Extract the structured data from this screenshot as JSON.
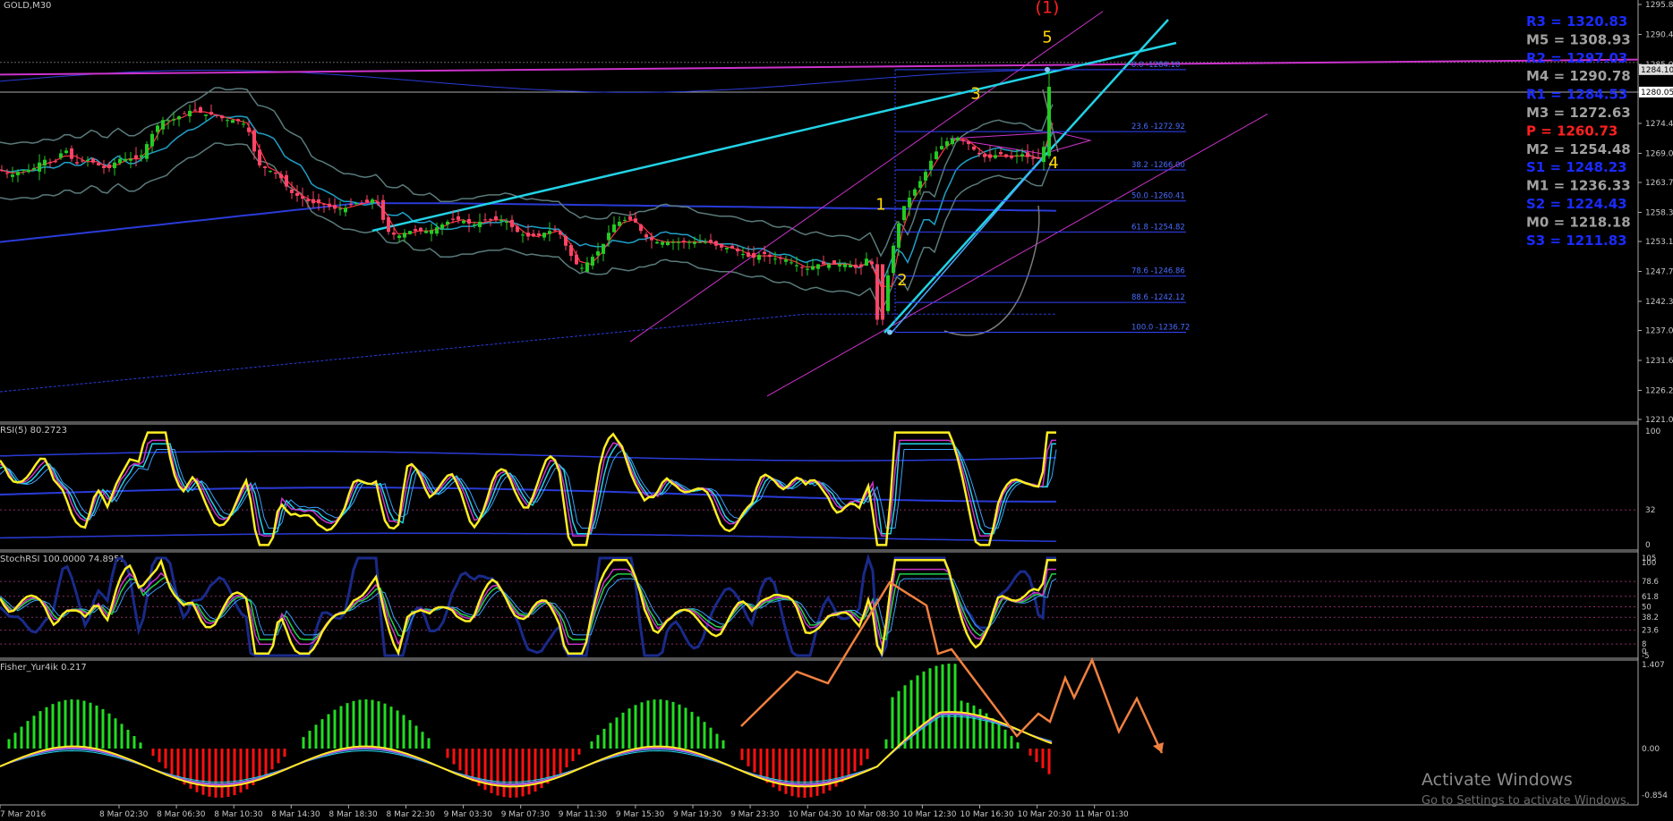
{
  "window": {
    "title": "GOLD,M30"
  },
  "colors": {
    "background": "#000000",
    "bull": "#22cc22",
    "bear": "#ff4466",
    "fib": "#3344ff",
    "channel": "#cc33cc",
    "trend": "#22d3e6",
    "wave": "#ffd700",
    "wave_major": "#ff2020",
    "forecast": "#f08040",
    "pivot_blue": "#1a2bff",
    "pivot_gray": "#a0a0a0",
    "pivot_red": "#ff2020"
  },
  "main_axis": {
    "price_labels": [
      "1295.85",
      "1290.45",
      "1285.05",
      "1280.05",
      "1274.40",
      "1269.00",
      "1263.75",
      "1258.35",
      "1253.10",
      "1247.70",
      "1242.30",
      "1237.05",
      "1231.65",
      "1226.25",
      "1221.00"
    ],
    "marker_top": "1284.10",
    "marker_current": "1280.05"
  },
  "pivots": [
    {
      "label": "R3",
      "value": "1320.83",
      "color": "blue"
    },
    {
      "label": "M5",
      "value": "1308.93",
      "color": "gray"
    },
    {
      "label": "R2",
      "value": "1297.03",
      "color": "blue"
    },
    {
      "label": "M4",
      "value": "1290.78",
      "color": "gray"
    },
    {
      "label": "R1",
      "value": "1284.53",
      "color": "blue"
    },
    {
      "label": "M3",
      "value": "1272.63",
      "color": "gray"
    },
    {
      "label": "P",
      "value": "1260.73",
      "color": "red"
    },
    {
      "label": "M2",
      "value": "1254.48",
      "color": "gray"
    },
    {
      "label": "S1",
      "value": "1248.23",
      "color": "blue"
    },
    {
      "label": "M1",
      "value": "1236.33",
      "color": "gray"
    },
    {
      "label": "S2",
      "value": "1224.43",
      "color": "blue"
    },
    {
      "label": "M0",
      "value": "1218.18",
      "color": "gray"
    },
    {
      "label": "S3",
      "value": "1211.83",
      "color": "blue"
    }
  ],
  "fib_levels": [
    {
      "label": "0.0 -1284.10",
      "price": 1284.1
    },
    {
      "label": "23.6 -1272.92",
      "price": 1272.92
    },
    {
      "label": "38.2 -1266.00",
      "price": 1266.0
    },
    {
      "label": "50.0 -1260.41",
      "price": 1260.41
    },
    {
      "label": "61.8 -1254.82",
      "price": 1254.82
    },
    {
      "label": "78.6 -1246.86",
      "price": 1246.86
    },
    {
      "label": "88.6 -1242.12",
      "price": 1242.12
    },
    {
      "label": "100.0 -1236.72",
      "price": 1236.72
    }
  ],
  "waves": [
    {
      "label": "(1)",
      "x": 1170,
      "price": 1294.3,
      "major": true
    },
    {
      "label": "5",
      "x": 1170,
      "price": 1289.0
    },
    {
      "label": "3",
      "x": 1090,
      "price": 1278.8
    },
    {
      "label": "4",
      "x": 1177,
      "price": 1266.3
    },
    {
      "label": "1",
      "x": 984,
      "price": 1258.8
    },
    {
      "label": "2",
      "x": 1008,
      "price": 1245.2
    }
  ],
  "rsi_panel": {
    "title": "RSI(5) 80.2723",
    "levels": [
      "100",
      "32",
      "0"
    ]
  },
  "stoch_panel": {
    "title": "StochRSI 100.0000 74.8951",
    "levels": [
      "105",
      "100",
      "78.6",
      "61.8",
      "50",
      "38.2",
      "23.6",
      "8",
      "0",
      "-5"
    ]
  },
  "fisher_panel": {
    "title": "Fisher_Yur4ik 0.217",
    "levels": [
      "1.407",
      "0.00",
      "-0.854"
    ]
  },
  "time_labels": [
    "7 Mar 2016",
    "8 Mar 02:30",
    "8 Mar 06:30",
    "8 Mar 10:30",
    "8 Mar 14:30",
    "8 Mar 18:30",
    "8 Mar 22:30",
    "9 Mar 03:30",
    "9 Mar 07:30",
    "9 Mar 11:30",
    "9 Mar 15:30",
    "9 Mar 19:30",
    "9 Mar 23:30",
    "10 Mar 04:30",
    "10 Mar 08:30",
    "10 Mar 12:30",
    "10 Mar 16:30",
    "10 Mar 20:30",
    "11 Mar 01:30"
  ],
  "watermark": {
    "line1": "Activate Windows",
    "line2": "Go to Settings to activate Windows."
  },
  "chart_data": {
    "type": "candlestick",
    "symbol": "GOLD",
    "timeframe": "M30",
    "ylim": [
      1221.0,
      1295.85
    ],
    "close_path": [
      [
        0,
        1266
      ],
      [
        12,
        1265
      ],
      [
        24,
        1266
      ],
      [
        36,
        1266
      ],
      [
        48,
        1268
      ],
      [
        60,
        1267
      ],
      [
        72,
        1270
      ],
      [
        84,
        1267
      ],
      [
        96,
        1268
      ],
      [
        108,
        1267
      ],
      [
        120,
        1266
      ],
      [
        132,
        1268
      ],
      [
        144,
        1268
      ],
      [
        156,
        1268
      ],
      [
        168,
        1272
      ],
      [
        180,
        1275
      ],
      [
        192,
        1275
      ],
      [
        204,
        1276
      ],
      [
        216,
        1277
      ],
      [
        228,
        1276
      ],
      [
        240,
        1276
      ],
      [
        252,
        1275
      ],
      [
        264,
        1275
      ],
      [
        276,
        1274
      ],
      [
        288,
        1267
      ],
      [
        300,
        1266
      ],
      [
        312,
        1265
      ],
      [
        324,
        1262
      ],
      [
        336,
        1261
      ],
      [
        348,
        1260
      ],
      [
        360,
        1260
      ],
      [
        372,
        1259
      ],
      [
        384,
        1259
      ],
      [
        396,
        1260
      ],
      [
        408,
        1260
      ],
      [
        420,
        1261
      ],
      [
        432,
        1255
      ],
      [
        444,
        1254
      ],
      [
        456,
        1255
      ],
      [
        468,
        1255
      ],
      [
        480,
        1255
      ],
      [
        492,
        1256
      ],
      [
        504,
        1257
      ],
      [
        516,
        1257
      ],
      [
        528,
        1256
      ],
      [
        540,
        1257
      ],
      [
        552,
        1257
      ],
      [
        564,
        1257
      ],
      [
        576,
        1255
      ],
      [
        588,
        1254
      ],
      [
        600,
        1254
      ],
      [
        612,
        1255
      ],
      [
        624,
        1255
      ],
      [
        636,
        1251
      ],
      [
        648,
        1248
      ],
      [
        660,
        1250
      ],
      [
        672,
        1252
      ],
      [
        684,
        1256
      ],
      [
        696,
        1257
      ],
      [
        708,
        1257
      ],
      [
        720,
        1254
      ],
      [
        732,
        1253
      ],
      [
        744,
        1253
      ],
      [
        756,
        1253
      ],
      [
        768,
        1253
      ],
      [
        780,
        1253
      ],
      [
        792,
        1253
      ],
      [
        804,
        1252
      ],
      [
        816,
        1252
      ],
      [
        828,
        1251
      ],
      [
        840,
        1250
      ],
      [
        852,
        1251
      ],
      [
        864,
        1250
      ],
      [
        876,
        1250
      ],
      [
        888,
        1249
      ],
      [
        900,
        1248
      ],
      [
        912,
        1249
      ],
      [
        924,
        1249
      ],
      [
        936,
        1249
      ],
      [
        948,
        1249
      ],
      [
        960,
        1248
      ],
      [
        972,
        1251
      ],
      [
        984,
        1239
      ],
      [
        996,
        1251
      ],
      [
        1008,
        1259
      ],
      [
        1020,
        1262
      ],
      [
        1032,
        1265
      ],
      [
        1044,
        1269
      ],
      [
        1056,
        1271
      ],
      [
        1068,
        1272
      ],
      [
        1080,
        1271
      ],
      [
        1092,
        1269
      ],
      [
        1104,
        1268
      ],
      [
        1116,
        1269
      ],
      [
        1128,
        1268
      ],
      [
        1140,
        1269
      ],
      [
        1152,
        1268
      ],
      [
        1164,
        1268
      ],
      [
        1176,
        1281
      ]
    ]
  }
}
